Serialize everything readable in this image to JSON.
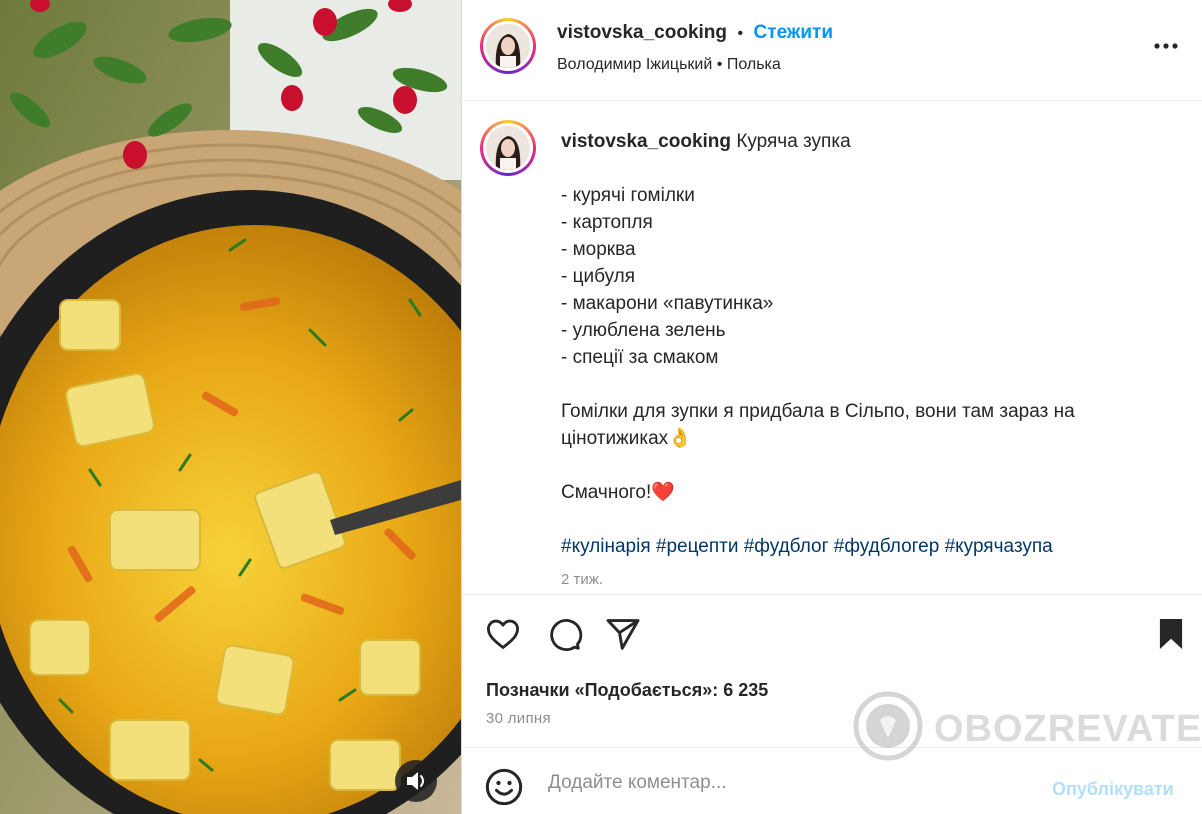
{
  "post": {
    "username": "vistovska_cooking",
    "follow_separator": "•",
    "follow_label": "Стежити",
    "audio_artist": "Володимир Іжицький",
    "audio_sep": "•",
    "audio_title": "Полька"
  },
  "caption": {
    "username": "vistovska_cooking",
    "title": "Куряча зупка",
    "ingredients": [
      "- курячі гомілки",
      "- картопля",
      "- морква",
      "- цибуля",
      "- макарони «павутинка»",
      "- улюблена зелень",
      "- спеції за смаком"
    ],
    "note_line1": "Гомілки для зупки я придбала в Сільпо, вони там зараз на",
    "note_line2": "цінотижиках👌",
    "closing": "Смачного!❤️",
    "hashtags": [
      "#кулінарія",
      "#рецепти",
      "#фудблог",
      "#фудблогер",
      "#курячазупа"
    ],
    "age": "2 тиж."
  },
  "actions": {
    "likes_label": "Позначки «Подобається»: 6 235",
    "date": "30 липня"
  },
  "comment": {
    "placeholder": "Додайте коментар...",
    "publish_label": "Опублікувати"
  },
  "watermark": {
    "text": "OBOZREVATEL"
  },
  "icons": {
    "more": "more-horizontal-icon",
    "like": "heart-icon",
    "comment": "comment-bubble-icon",
    "share": "paper-plane-icon",
    "save": "bookmark-icon",
    "emoji": "emoji-smile-icon",
    "sound": "speaker-icon"
  },
  "colors": {
    "link": "#0095f6",
    "hashtag": "#00376b",
    "muted": "#8e8e8e",
    "publish_disabled": "#b2dffc"
  }
}
